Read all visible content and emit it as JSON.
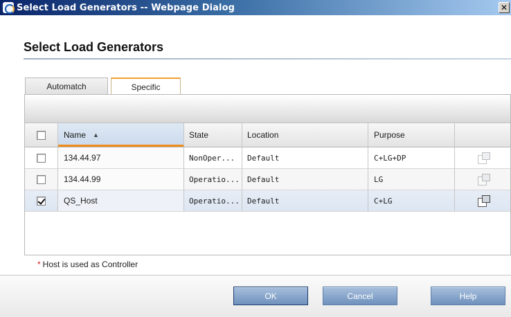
{
  "window": {
    "title": "Select Load Generators -- Webpage Dialog",
    "close_glyph": "✕"
  },
  "heading": "Select Load Generators",
  "tabs": [
    {
      "label": "Automatch",
      "active": false
    },
    {
      "label": "Specific",
      "active": true
    }
  ],
  "grid": {
    "columns": {
      "name": "Name",
      "state": "State",
      "location": "Location",
      "purpose": "Purpose"
    },
    "sort_indicator": "▲",
    "rows": [
      {
        "checked": false,
        "name": "134.44.97",
        "state": "NonOper...",
        "location": "Default",
        "purpose": "C+LG+DP",
        "icon": "properties-icon"
      },
      {
        "checked": false,
        "name": "134.44.99",
        "state": "Operatio...",
        "location": "Default",
        "purpose": "LG",
        "icon": "properties-icon"
      },
      {
        "checked": true,
        "name": "QS_Host",
        "state": "Operatio...",
        "location": "Default",
        "purpose": "C+LG",
        "icon": "properties-icon"
      }
    ]
  },
  "footnote": {
    "star": "*",
    "text": "Host is used as Controller"
  },
  "buttons": {
    "ok": "OK",
    "cancel": "Cancel",
    "help": "Help"
  },
  "colors": {
    "accent": "#f08c1a",
    "title_bar": "#0a246a",
    "button": "#6f91bd",
    "footnote_star": "#d41e1e"
  }
}
